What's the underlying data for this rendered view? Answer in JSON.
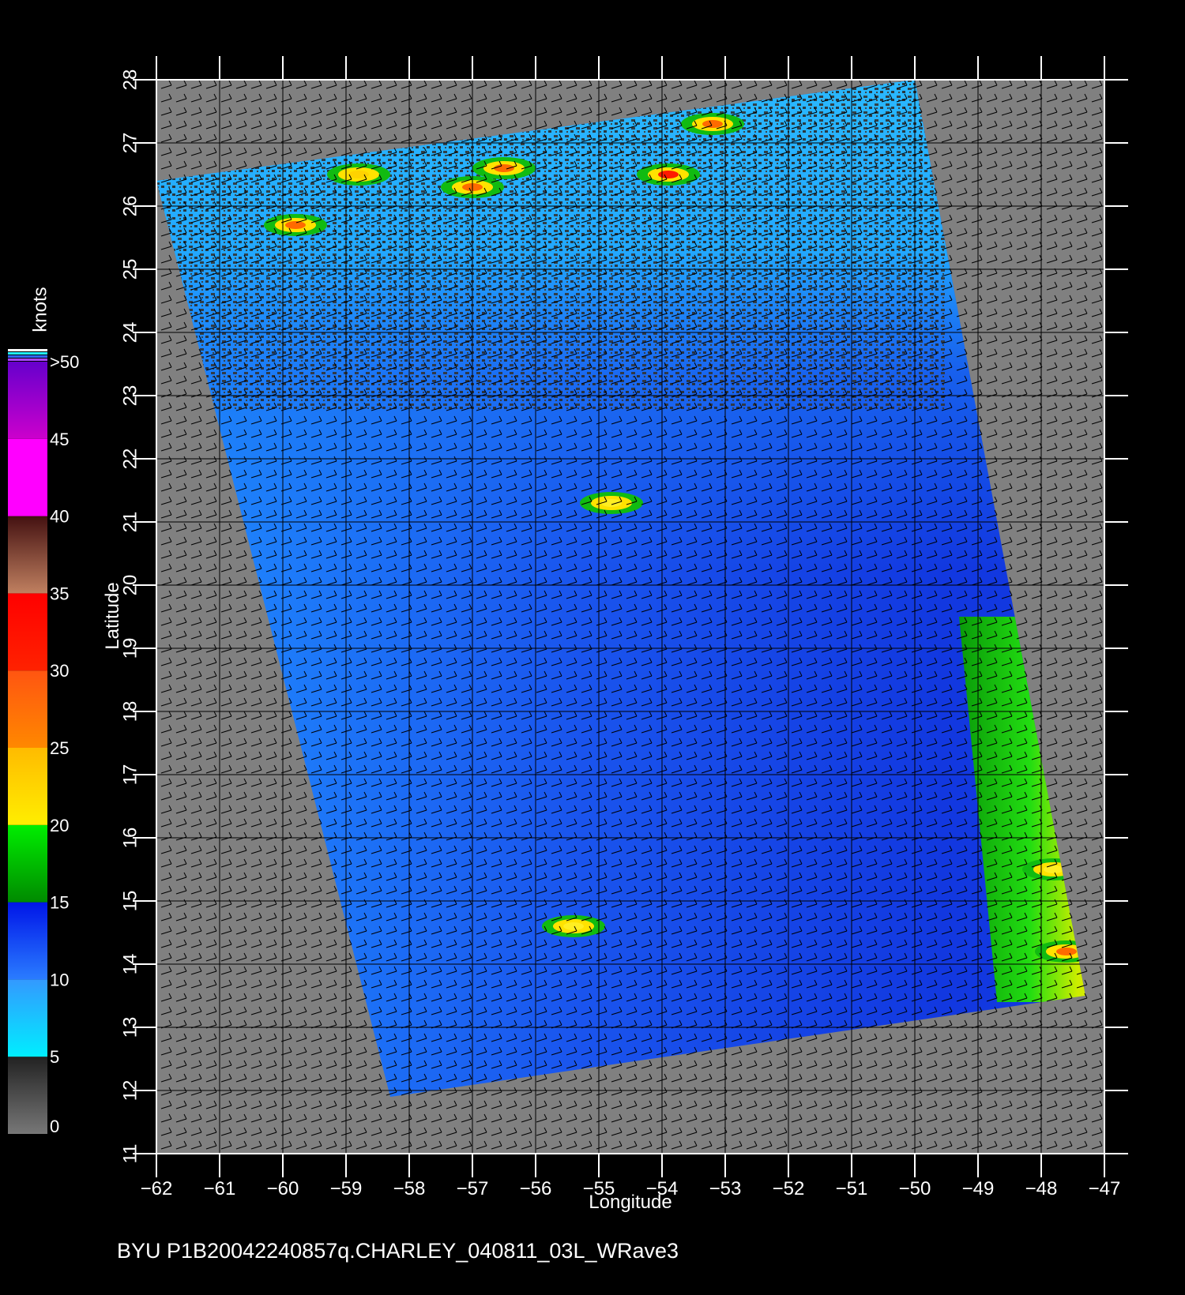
{
  "footer_text": "BYU  P1B20042240857q.CHARLEY_040811_03L_WRave3",
  "x_axis": {
    "label": "Longitude",
    "ticks": [
      -62,
      -61,
      -60,
      -59,
      -58,
      -57,
      -56,
      -55,
      -54,
      -53,
      -52,
      -51,
      -50,
      -49,
      -48,
      -47
    ],
    "tick_labels": [
      "−62",
      "−61",
      "−60",
      "−59",
      "−58",
      "−57",
      "−56",
      "−55",
      "−54",
      "−53",
      "−52",
      "−51",
      "−50",
      "−49",
      "−48",
      "−47"
    ],
    "range": [
      -62,
      -47
    ]
  },
  "y_axis": {
    "label": "Latitude",
    "ticks": [
      11,
      12,
      13,
      14,
      15,
      16,
      17,
      18,
      19,
      20,
      21,
      22,
      23,
      24,
      25,
      26,
      27,
      28
    ],
    "tick_labels": [
      "11",
      "12",
      "13",
      "14",
      "15",
      "16",
      "17",
      "18",
      "19",
      "20",
      "21",
      "22",
      "23",
      "24",
      "25",
      "26",
      "27",
      "28"
    ],
    "range": [
      11,
      28
    ]
  },
  "colorbar": {
    "unit": "knots",
    "labels": [
      "0",
      "5",
      "10",
      "15",
      "20",
      "25",
      "30",
      "35",
      "40",
      "45",
      ">50"
    ],
    "segments": [
      {
        "from": 0,
        "to": 5,
        "colors": [
          "#777777",
          "#222222"
        ]
      },
      {
        "from": 5,
        "to": 10,
        "colors": [
          "#00eeff",
          "#3399ff"
        ]
      },
      {
        "from": 10,
        "to": 15,
        "colors": [
          "#2a7cff",
          "#0015e8"
        ]
      },
      {
        "from": 15,
        "to": 20,
        "colors": [
          "#008a00",
          "#00ee00"
        ]
      },
      {
        "from": 20,
        "to": 25,
        "colors": [
          "#ffee00",
          "#ffbb00"
        ]
      },
      {
        "from": 25,
        "to": 30,
        "colors": [
          "#ff8800",
          "#ff5511"
        ]
      },
      {
        "from": 30,
        "to": 35,
        "colors": [
          "#ff2200",
          "#ff0000"
        ]
      },
      {
        "from": 35,
        "to": 40,
        "colors": [
          "#c08060",
          "#441111"
        ]
      },
      {
        "from": 40,
        "to": 45,
        "colors": [
          "#ff00ff",
          "#ff00ff"
        ]
      },
      {
        "from": 45,
        "to": 50,
        "colors": [
          "#cc00cc",
          "#6600cc"
        ]
      }
    ]
  },
  "map": {
    "land_color": "#808080",
    "swath_corners_lonlat": [
      [
        -62.0,
        26.4
      ],
      [
        -50.0,
        28.0
      ],
      [
        -47.3,
        13.5
      ],
      [
        -58.3,
        11.9
      ]
    ],
    "high_wind_regions": [
      {
        "lon": -59.8,
        "lat": 25.7,
        "speed": 28
      },
      {
        "lon": -57.0,
        "lat": 26.3,
        "speed": 30
      },
      {
        "lon": -56.5,
        "lat": 26.6,
        "speed": 32
      },
      {
        "lon": -53.9,
        "lat": 26.5,
        "speed": 34
      },
      {
        "lon": -53.2,
        "lat": 27.3,
        "speed": 30
      },
      {
        "lon": -58.8,
        "lat": 26.5,
        "speed": 24
      },
      {
        "lon": -47.8,
        "lat": 15.5,
        "speed": 22
      },
      {
        "lon": -47.6,
        "lat": 14.2,
        "speed": 30
      },
      {
        "lon": -54.8,
        "lat": 21.3,
        "speed": 22
      },
      {
        "lon": -55.4,
        "lat": 14.6,
        "speed": 22
      }
    ]
  }
}
